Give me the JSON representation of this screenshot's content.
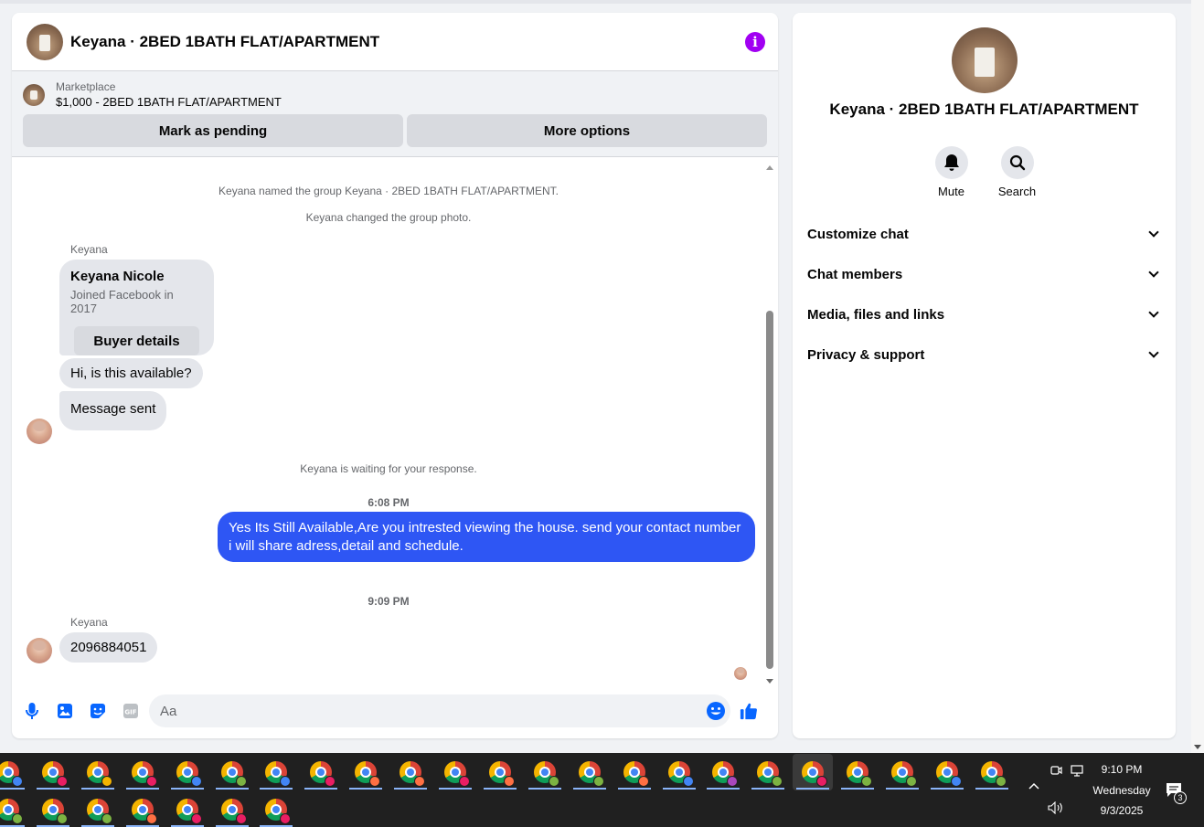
{
  "chat": {
    "title": "Keyana · 2BED 1BATH FLAT/APARTMENT",
    "listing": {
      "label": "Marketplace",
      "price_title": "$1,000 - 2BED 1BATH FLAT/APARTMENT",
      "mark_pending": "Mark as pending",
      "more_options": "More options"
    },
    "messages": {
      "sys_named": "Keyana named the group Keyana · 2BED 1BATH FLAT/APARTMENT.",
      "sys_photo": "Keyana changed the group photo.",
      "sender1": "Keyana",
      "card_name": "Keyana Nicole",
      "card_sub": "Joined Facebook in 2017",
      "card_button": "Buyer details",
      "msg1": "Hi, is this available?",
      "msg2": "Message sent",
      "sys_waiting": "Keyana is waiting for your response.",
      "time1": "6:08 PM",
      "msg_out": "Yes Its Still Available,Are you intrested viewing the house. send your contact number i will share adress,detail and schedule.",
      "time2": "9:09 PM",
      "sender2": "Keyana",
      "msg3": "2096884051"
    },
    "composer": {
      "placeholder": "Aa"
    }
  },
  "info": {
    "title": "Keyana · 2BED 1BATH FLAT/APARTMENT",
    "mute_label": "Mute",
    "search_label": "Search",
    "sections": [
      "Customize chat",
      "Chat members",
      "Media, files and links",
      "Privacy & support"
    ]
  },
  "taskbar": {
    "time": "9:10 PM",
    "day": "Wednesday",
    "date": "9/3/2025",
    "notification_count": "3",
    "row1_profiles": [
      "#4285f4",
      "#e91e63",
      "#f4b400",
      "#e91e63",
      "#4285f4",
      "#7cb342",
      "#4285f4",
      "#e91e63",
      "#ff7043",
      "#ff7043",
      "#e91e63",
      "#ff7043",
      "#7cb342",
      "#7cb342",
      "#ff7043",
      "#4285f4",
      "#ab47bc",
      "#7cb342",
      "#e91e63",
      "#7cb342",
      "#7cb342",
      "#4285f4",
      "#7cb342"
    ],
    "row2_profiles": [
      "#7cb342",
      "#7cb342",
      "#7cb342",
      "#ff7043",
      "#e91e63",
      "#e91e63",
      "#e91e63"
    ],
    "active_index": 18,
    "accent": "#8ab4f8"
  },
  "colors": {
    "outgoing_bubble": "#2e56f4",
    "messenger_blue": "#0866ff",
    "info_purple": "#a100f2"
  }
}
